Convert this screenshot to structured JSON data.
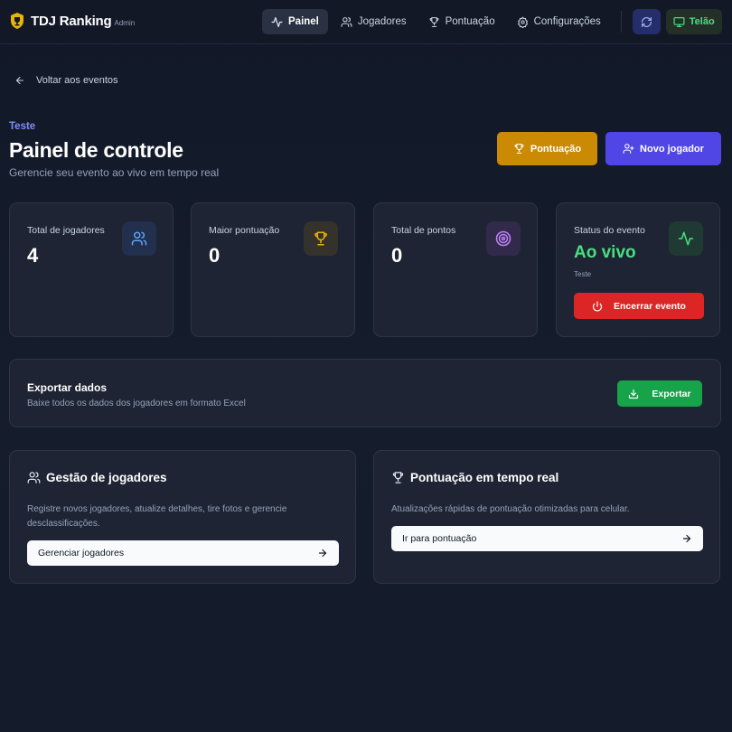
{
  "app": {
    "name": "TDJ Ranking",
    "tag": "Admin"
  },
  "nav": {
    "items": [
      {
        "label": "Painel",
        "active": true
      },
      {
        "label": "Jogadores"
      },
      {
        "label": "Pontuação"
      },
      {
        "label": "Configurações"
      }
    ],
    "telao_label": "Telão"
  },
  "back_label": "Voltar aos eventos",
  "header": {
    "event_name": "Teste",
    "title": "Painel de controle",
    "subtitle": "Gerencie seu evento ao vivo em tempo real",
    "score_button": "Pontuação",
    "new_player_button": "Novo jogador"
  },
  "stats": {
    "players": {
      "label": "Total de jogadores",
      "value": "4"
    },
    "top_score": {
      "label": "Maior pontuação",
      "value": "0"
    },
    "total_points": {
      "label": "Total de pontos",
      "value": "0"
    },
    "status": {
      "label": "Status do evento",
      "value": "Ao vivo",
      "event": "Teste",
      "end_button": "Encerrar evento"
    }
  },
  "export": {
    "title": "Exportar dados",
    "subtitle": "Baixe todos os dados dos jogadores em formato Excel",
    "button": "Exportar"
  },
  "features": {
    "players": {
      "title": "Gestão de jogadores",
      "description": "Registre novos jogadores, atualize detalhes, tire fotos e gerencie desclassificações.",
      "button": "Gerenciar jogadores"
    },
    "scoring": {
      "title": "Pontuação em tempo real",
      "description": "Atualizações rápidas de pontuação otimizadas para celular.",
      "button": "Ir para pontuação"
    }
  },
  "colors": {
    "accent_indigo": "#5046e5",
    "gold": "#ca8a04",
    "live_green": "#4ade80",
    "danger_red": "#dc2626",
    "export_green": "#16a34a"
  },
  "icons": [
    "shield-trophy-icon",
    "activity-icon",
    "users-icon",
    "trophy-icon",
    "settings-icon",
    "refresh-icon",
    "monitor-icon",
    "arrow-left-icon",
    "user-plus-icon",
    "target-icon",
    "power-icon",
    "download-icon",
    "arrow-right-icon"
  ]
}
